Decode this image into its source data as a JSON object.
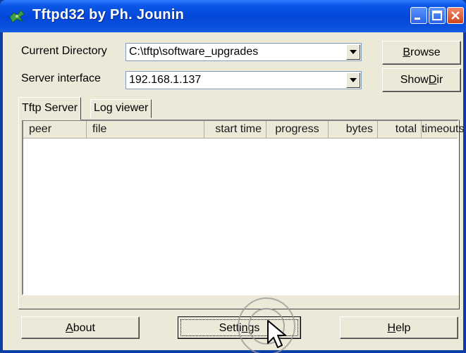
{
  "window": {
    "title": "Tftpd32 by Ph.  Jounin",
    "icon": "tftpd-app-icon",
    "controls": [
      "minimize-icon",
      "maximize-icon",
      "close-icon"
    ]
  },
  "current_directory": {
    "label": "Current Directory",
    "value": "C:\\tftp\\software_upgrades"
  },
  "server_interface": {
    "label": "Server interface",
    "value": "192.168.1.137"
  },
  "buttons": {
    "browse": {
      "label_ul": "B",
      "label_rest": "rowse"
    },
    "show_dir": {
      "label_pre": "Show ",
      "label_ul": "D",
      "label_rest": "ir"
    },
    "about": {
      "label_ul": "A",
      "label_rest": "bout"
    },
    "settings": {
      "label_pre": "Setti",
      "label_ul": "n",
      "label_rest": "gs"
    },
    "help": {
      "label_ul": "H",
      "label_rest": "elp"
    }
  },
  "tabs": [
    {
      "label": "Tftp Server",
      "active": true
    },
    {
      "label": "Log viewer",
      "active": false
    }
  ],
  "table": {
    "columns": [
      "peer",
      "file",
      "start time",
      "progress",
      "bytes",
      "total",
      "timeouts"
    ],
    "rows": []
  },
  "cursor": {
    "icon": "arrow-cursor-icon",
    "click_indicator": "click-ripple"
  }
}
